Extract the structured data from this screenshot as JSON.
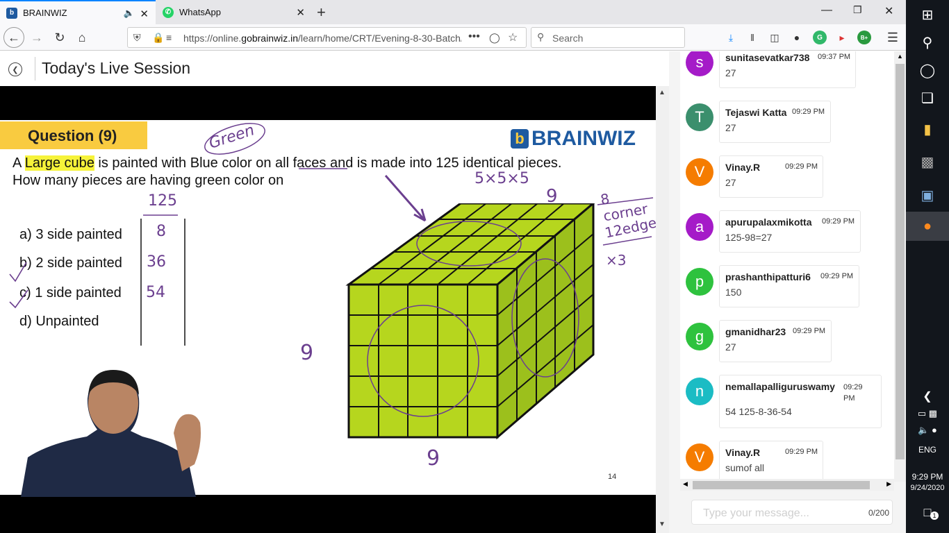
{
  "browser": {
    "tabs": [
      {
        "label": "BRAINWIZ",
        "active": true
      },
      {
        "label": "WhatsApp",
        "active": false
      }
    ],
    "url_prefix": "https://online.",
    "url_domain": "gobrainwiz.in",
    "url_path": "/learn/home/CRT/Evening-8-30-Batch/",
    "search_placeholder": "Search"
  },
  "page": {
    "title": "Today's Live Session"
  },
  "slide": {
    "question_label": "Question (9)",
    "brand": "BRAINWIZ",
    "q_line1_pre": "A ",
    "q_line1_hl": "Large cube",
    "q_line1_post": " is painted with Blue color on all faces and is made into 125 identical pieces.",
    "q_line2": "How many pieces are having green color on",
    "options": [
      "a) 3 side painted",
      "b) 2 side painted",
      "c) 1 side painted",
      "d) Unpainted"
    ],
    "handwritten": {
      "green": "Green",
      "total": "125",
      "answers": [
        "8",
        "36",
        "54"
      ],
      "dims": "5×5×5",
      "corner": "8 corner",
      "edges": "12edges",
      "times3": "×3",
      "nine": "9"
    },
    "page_number": "14"
  },
  "chat": {
    "messages": [
      {
        "initial": "s",
        "color": "#a51bc8",
        "name": "sunitasevatkar738",
        "time": "09:37 PM",
        "text": "27"
      },
      {
        "initial": "T",
        "color": "#3b8f6d",
        "name": "Tejaswi Katta",
        "time": "09:29 PM",
        "text": "27"
      },
      {
        "initial": "V",
        "color": "#f57c00",
        "name": "Vinay.R",
        "time": "09:29 PM",
        "text": "27"
      },
      {
        "initial": "a",
        "color": "#a51bc8",
        "name": "apurupalaxmikotta",
        "time": "09:29 PM",
        "text": "125-98=27"
      },
      {
        "initial": "p",
        "color": "#2ec23e",
        "name": "prashanthipatturi6",
        "time": "09:29 PM",
        "text": "150"
      },
      {
        "initial": "g",
        "color": "#2ec23e",
        "name": "gmanidhar23",
        "time": "09:29 PM",
        "text": "27"
      },
      {
        "initial": "n",
        "color": "#1bbcc4",
        "name": "nemallapalliguruswamy",
        "time": "09:29 PM",
        "text": "54 125-8-36-54"
      },
      {
        "initial": "V",
        "color": "#f57c00",
        "name": "Vinay.R",
        "time": "09:29 PM",
        "text": "sumof all"
      }
    ],
    "input_placeholder": "Type your message...",
    "char_count": "0/200"
  },
  "taskbar": {
    "language": "ENG",
    "time": "9:29 PM",
    "date": "9/24/2020",
    "notification_count": "1"
  }
}
